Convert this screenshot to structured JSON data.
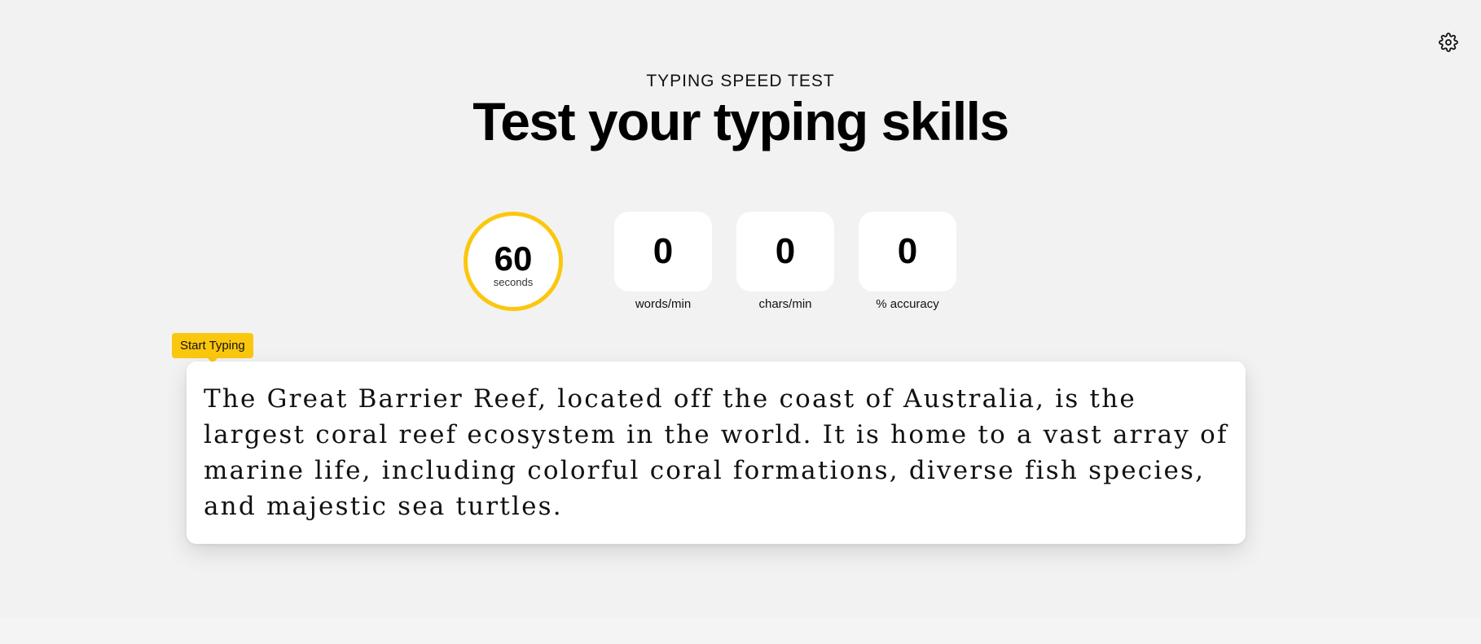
{
  "header": {
    "eyebrow": "TYPING SPEED TEST",
    "title": "Test your typing skills"
  },
  "settings": {
    "icon": "gear-icon"
  },
  "timer": {
    "value": "60",
    "unit": "seconds",
    "ring_color": "#fbc70e"
  },
  "stats": [
    {
      "value": "0",
      "label": "words/min"
    },
    {
      "value": "0",
      "label": "chars/min"
    },
    {
      "value": "0",
      "label": "% accuracy"
    }
  ],
  "tooltip": {
    "label": "Start Typing",
    "color": "#fbc70e"
  },
  "passage": {
    "text": "The Great Barrier Reef, located off the coast of Australia, is the largest coral reef ecosystem in the world. It is home to a vast array of marine life, including colorful coral formations, diverse fish species, and majestic sea turtles."
  }
}
